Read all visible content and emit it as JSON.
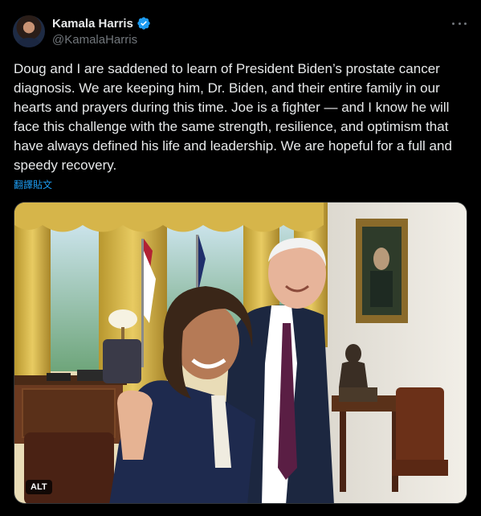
{
  "author": {
    "display_name": "Kamala Harris",
    "handle": "@KamalaHarris",
    "verified": true,
    "avatar": "avatar"
  },
  "post": {
    "text": "Doug and I are saddened to learn of President Biden’s prostate cancer diagnosis. We are keeping him, Dr. Biden, and their entire family in our hearts and prayers during this time. Joe is a fighter — and I know he will face this challenge with the same strength, resilience, and optimism that have always defined his life and leadership. We are hopeful for a full and speedy recovery.",
    "translate_label": "翻譯貼文"
  },
  "media": {
    "alt_label": "ALT",
    "image": "photo"
  },
  "icons": {
    "verified": "verified-badge-icon",
    "more": "more-options-icon"
  },
  "colors": {
    "background": "#000000",
    "text": "#e7e9ea",
    "secondary": "#71767b",
    "link": "#1d9bf0",
    "verified": "#1d9bf0"
  }
}
